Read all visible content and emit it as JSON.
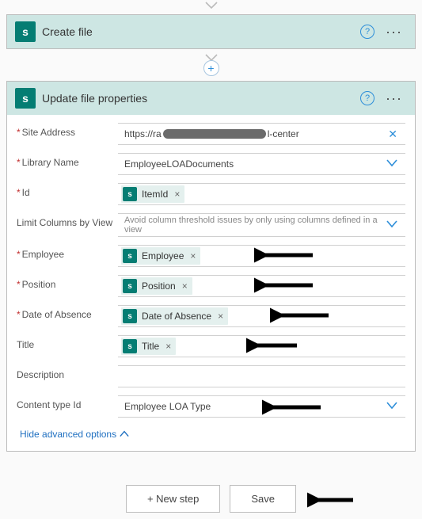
{
  "createCard": {
    "title": "Create file"
  },
  "updateCard": {
    "title": "Update file properties",
    "siteAddress": {
      "label": "Site Address",
      "prefix": "https://ra",
      "suffix": "l-center"
    },
    "libraryName": {
      "label": "Library Name",
      "value": "EmployeeLOADocuments"
    },
    "id": {
      "label": "Id",
      "pill": "ItemId"
    },
    "limitColumns": {
      "label": "Limit Columns by View",
      "placeholder": "Avoid column threshold issues by only using columns defined in a view"
    },
    "employee": {
      "label": "Employee",
      "pill": "Employee"
    },
    "position": {
      "label": "Position",
      "pill": "Position"
    },
    "dateOfAbsence": {
      "label": "Date of Absence",
      "pill": "Date of Absence"
    },
    "titleField": {
      "label": "Title",
      "pill": "Title"
    },
    "description": {
      "label": "Description"
    },
    "contentTypeId": {
      "label": "Content type Id",
      "value": "Employee LOA Type"
    },
    "advanced": "Hide advanced options"
  },
  "footer": {
    "newStep": "+ New step",
    "save": "Save"
  }
}
